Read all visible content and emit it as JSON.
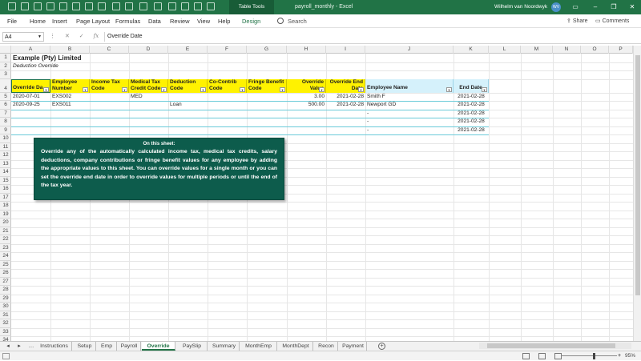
{
  "titlebar": {
    "context_tab": "Table Tools",
    "doc_title": "payroll_monthly  -  Excel",
    "user": "Wilhelm van Noordwyk",
    "avatar": "WV",
    "accent": "#217346"
  },
  "ribbon": {
    "tabs": [
      "File",
      "Home",
      "Insert",
      "Page Layout",
      "Formulas",
      "Data",
      "Review",
      "View",
      "Help",
      "Design"
    ],
    "search_placeholder": "Search",
    "share_label": "Share",
    "comments_label": "Comments"
  },
  "formula_bar": {
    "name_box": "A4",
    "fx_label": "fx",
    "content": "Override Date"
  },
  "columns": [
    "A",
    "B",
    "C",
    "D",
    "E",
    "F",
    "G",
    "H",
    "I",
    "J",
    "K",
    "L",
    "M",
    "N",
    "O",
    "P"
  ],
  "rows": [
    "1",
    "2",
    "3",
    "4",
    "5",
    "6",
    "7",
    "8",
    "9",
    "10",
    "11",
    "12",
    "13",
    "14",
    "15",
    "16",
    "17",
    "18",
    "19",
    "20",
    "21",
    "22",
    "23",
    "24",
    "25",
    "26",
    "27",
    "28",
    "29",
    "30",
    "31",
    "32",
    "33",
    "34"
  ],
  "sheet": {
    "title": "Example (Pty) Limited",
    "subtitle": "Deduction Override",
    "headers": [
      "Override Da",
      "Employee Number",
      "Income Tax Code",
      "Medical Tax Credit Code",
      "Deduction Code",
      "Co-Contrib Code",
      "Fringe Benefit Code",
      "Override Value",
      "Override End Date",
      "Employee Name",
      "End Date"
    ],
    "table_rows": [
      [
        "2020-07-01",
        "EXS002",
        "",
        "MED",
        "",
        "",
        "",
        "3.00",
        "2021-02-28",
        "Smith F",
        "2021-02-28"
      ],
      [
        "2020-09-25",
        "EXS011",
        "",
        "",
        "Loan",
        "",
        "",
        "500.00",
        "2021-02-28",
        "Newport GD",
        "2021-02-28"
      ],
      [
        "",
        "",
        "",
        "",
        "",
        "",
        "",
        "",
        "",
        "-",
        "2021-02-28"
      ],
      [
        "",
        "",
        "",
        "",
        "",
        "",
        "",
        "",
        "",
        "-",
        "2021-02-28"
      ],
      [
        "",
        "",
        "",
        "",
        "",
        "",
        "",
        "",
        "",
        "-",
        "2021-02-28"
      ]
    ]
  },
  "note": {
    "title": "On this sheet:",
    "body": "Override any of the automatically calculated income tax, medical tax credits, salary deductions, company contributions or fringe benefit values for any employee by adding the appropriate values to this sheet. You can override values for a single month or you can set the override end date in order to override values for multiple periods or until the end of the tax year."
  },
  "sheet_tabs": [
    "Instructions",
    "Setup",
    "Emp",
    "Payroll",
    "Override",
    "PaySlip",
    "Summary",
    "MonthEmp",
    "MonthDept",
    "Recon",
    "Payment"
  ],
  "active_sheet": "Override",
  "status": {
    "zoom": "95%"
  }
}
